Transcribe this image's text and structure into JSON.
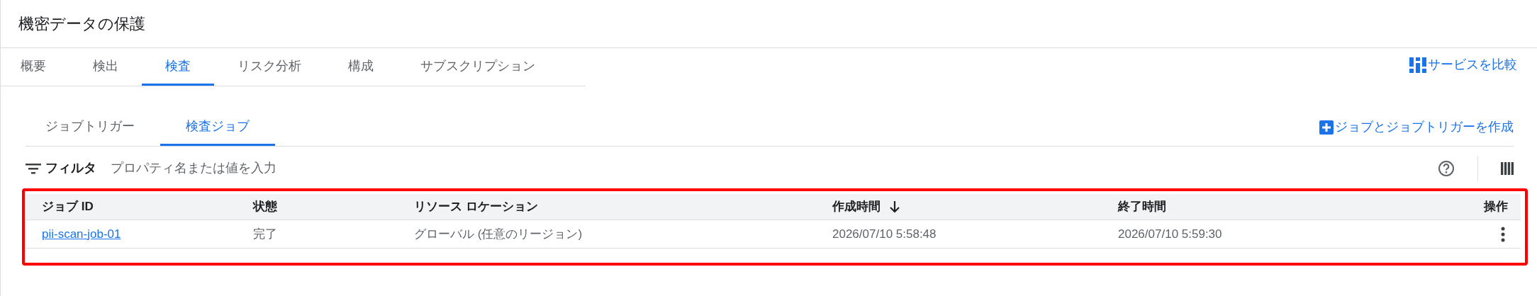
{
  "header": {
    "title": "機密データの保護"
  },
  "tabs": [
    {
      "label": "概要",
      "selected": false
    },
    {
      "label": "検出",
      "selected": false
    },
    {
      "label": "検査",
      "selected": true
    },
    {
      "label": "リスク分析",
      "selected": false
    },
    {
      "label": "構成",
      "selected": false
    },
    {
      "label": "サブスクリプション",
      "selected": false
    }
  ],
  "compare_link": {
    "label": "サービスを比較"
  },
  "subtabs": [
    {
      "label": "ジョブトリガー",
      "selected": false
    },
    {
      "label": "検査ジョブ",
      "selected": true
    }
  ],
  "create_link": {
    "label": "ジョブとジョブトリガーを作成"
  },
  "filter": {
    "label": "フィルタ",
    "placeholder": "プロパティ名または値を入力"
  },
  "table": {
    "highlighted": true,
    "columns": [
      {
        "label": "ジョブ ID",
        "sorted": false
      },
      {
        "label": "状態",
        "sorted": false
      },
      {
        "label": "リソース ロケーション",
        "sorted": false
      },
      {
        "label": "作成時間",
        "sorted": true
      },
      {
        "label": "終了時間",
        "sorted": false
      },
      {
        "label": "操作",
        "sorted": false
      }
    ],
    "rows": [
      {
        "cells": [
          "pii-scan-job-01",
          "完了",
          "グローバル (任意のリージョン)",
          "2026/07/10 5:58:48",
          "2026/07/10 5:59:30"
        ]
      }
    ]
  }
}
